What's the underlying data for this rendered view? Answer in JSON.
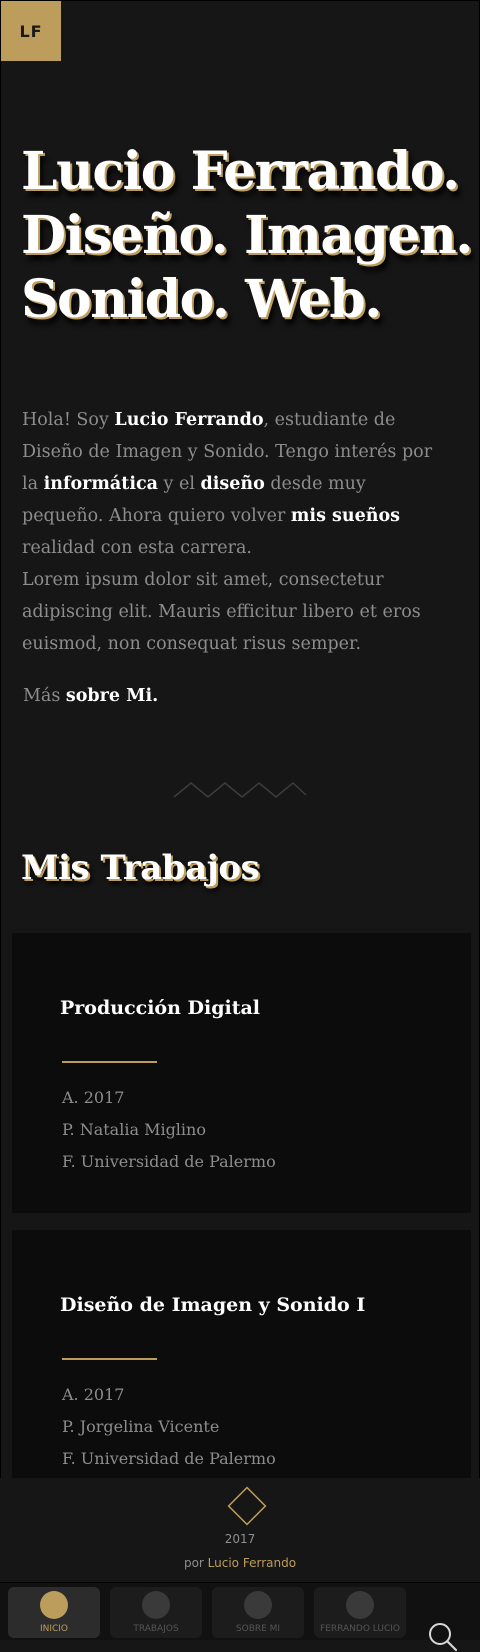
{
  "brand": {
    "logo_text": "LF"
  },
  "hero": {
    "lines": [
      "Lucio Ferrando.",
      "Diseño. Imagen.",
      "Sonido. Web."
    ]
  },
  "intro": {
    "p1": [
      "Hola! Soy ",
      "Lucio Ferrando",
      ", estudiante de Diseño de Imagen y Sonido. Tengo interés por la ",
      "in­formática",
      " y el ",
      "diseño",
      " desde muy pequeño. Ahora quiero volver ",
      "mis sueños",
      " realidad con esta carre­ra."
    ],
    "p2": "Lorem ipsum dolor sit amet, consectetur adipisc­ing elit. Mauris efficitur libero et eros euismod, non consequat risus semper.",
    "more_prefix": "Más ",
    "more_link": "sobre Mi."
  },
  "works": {
    "title": "Mis Trabajos",
    "items": [
      {
        "title": "Producción Digital",
        "meta": [
          "A. 2017",
          "P. Natalia Miglino",
          "F. Universidad de Palermo"
        ]
      },
      {
        "title": "Diseño de Imagen y Sonido I",
        "meta": [
          "A. 2017",
          "P. Jorgelina Vicente",
          "F. Universidad de Palermo"
        ]
      }
    ]
  },
  "footer": {
    "year": "2017",
    "by_prefix": "por ",
    "by_name": "Lucio Ferrando"
  },
  "nav": {
    "items": [
      {
        "label": "INICIO",
        "active": true
      },
      {
        "label": "TRABAJOS",
        "active": false
      },
      {
        "label": "SOBRE MI",
        "active": false
      },
      {
        "label": "FERRANDO LUCIO",
        "active": false
      }
    ],
    "search_icon": "search-icon"
  },
  "colors": {
    "accent": "#bd9d5c",
    "background": "#161616",
    "card": "#0c0c0c",
    "text_muted": "#8d8d8d"
  }
}
